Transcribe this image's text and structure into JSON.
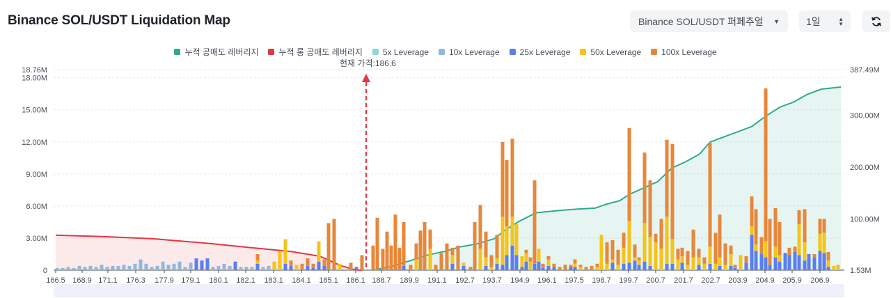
{
  "header": {
    "title": "Binance SOL/USDT Liquidation Map",
    "pair_select": "Binance SOL/USDT 퍼페추얼",
    "period_select": "1일",
    "refresh_icon": "refresh-icon"
  },
  "colors": {
    "short_cum": "#2eaa8e",
    "long_cum": "#e5353f",
    "lev5": "#8fd6d5",
    "lev10": "#8fb8de",
    "lev25": "#5b7ef0",
    "lev50": "#f5c419",
    "lev100": "#e7873a"
  },
  "chart_data": {
    "type": "bar",
    "legend": [
      {
        "name": "누적 공매도 레버리지",
        "color": "#2eaa8e"
      },
      {
        "name": "누적 롱 공매도 레버리지",
        "color": "#e5353f"
      },
      {
        "name": "5x Leverage",
        "color": "#8fd6d5"
      },
      {
        "name": "10x Leverage",
        "color": "#8fb8de"
      },
      {
        "name": "25x Leverage",
        "color": "#5b7ef0"
      },
      {
        "name": "50x Leverage",
        "color": "#f5c419"
      },
      {
        "name": "100x Leverage",
        "color": "#e7873a"
      }
    ],
    "legend_position": "top-center",
    "current_price_label": "현재 가격:186.6",
    "current_price": 186.6,
    "x_ticks": [
      "166.5",
      "168.9",
      "171.1",
      "176.3",
      "177.9",
      "179.1",
      "180.1",
      "182.1",
      "183.1",
      "184.1",
      "185.1",
      "186.1",
      "188.7",
      "189.9",
      "191.1",
      "192.7",
      "193.7",
      "194.9",
      "196.1",
      "197.5",
      "198.7",
      "199.7",
      "200.7",
      "201.7",
      "202.7",
      "203.9",
      "204.9",
      "205.9",
      "206.9"
    ],
    "y_left_ticks": [
      "0",
      "3.00M",
      "6.00M",
      "9.00M",
      "12.00M",
      "15.00M",
      "18.00M",
      "18.76M"
    ],
    "y_left_range": [
      0,
      18.76
    ],
    "y_right_ticks": [
      "1.53M",
      "100.00M",
      "200.00M",
      "300.00M",
      "387.49M"
    ],
    "y_right_range": [
      1.53,
      387.49
    ],
    "grid": "horizontal-dashed"
  }
}
